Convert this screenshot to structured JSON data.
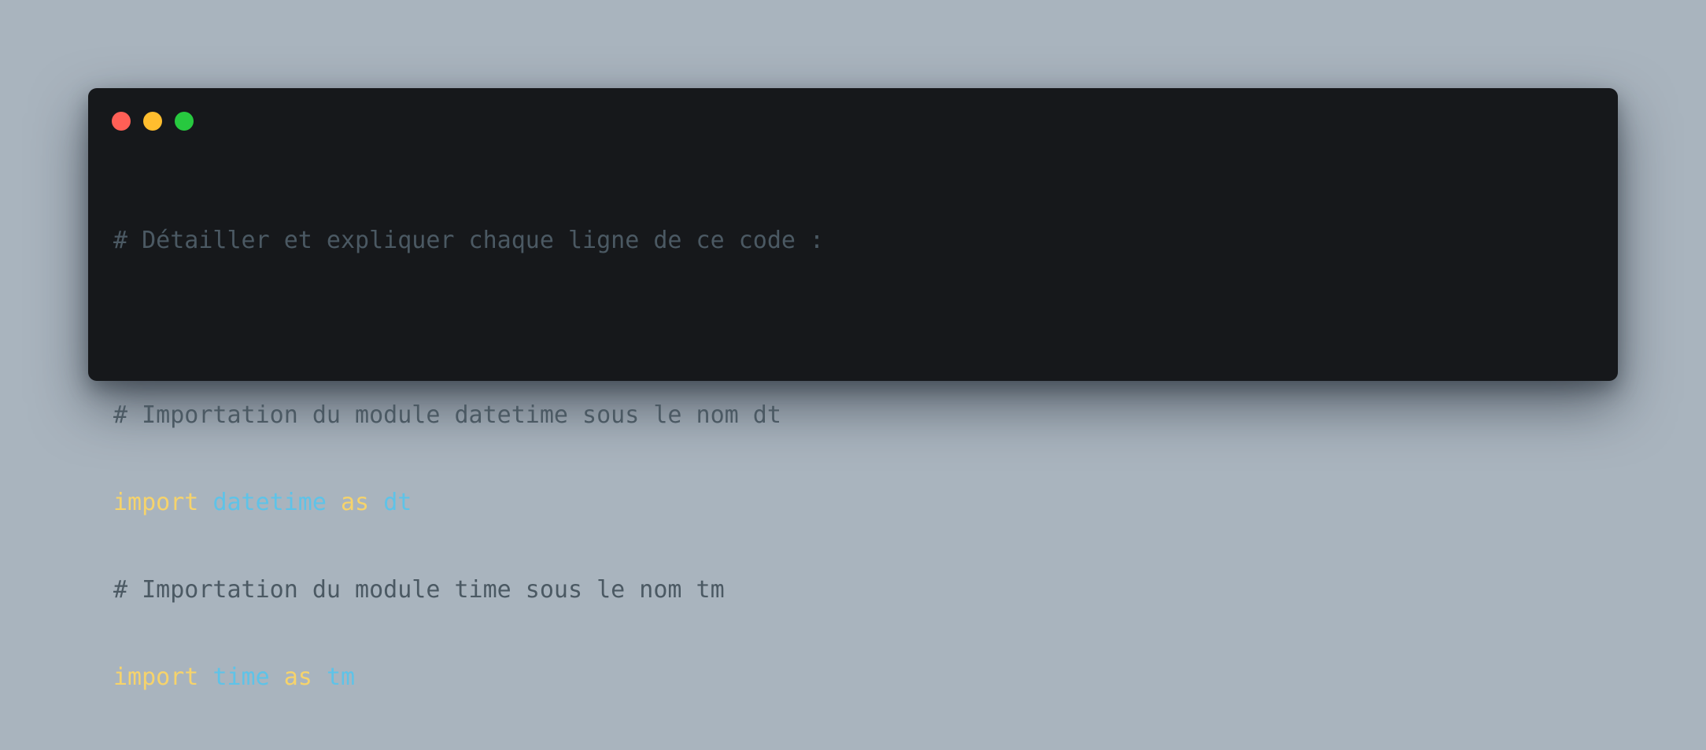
{
  "window": {
    "controls": [
      {
        "name": "close-dot",
        "color": "#ff5f56"
      },
      {
        "name": "minimize-dot",
        "color": "#ffbd2e"
      },
      {
        "name": "maximize-dot",
        "color": "#27c93f"
      }
    ]
  },
  "code": {
    "line1": {
      "comment": "# Détailler et expliquer chaque ligne de ce code :"
    },
    "line2": {
      "comment": "# Importation du module datetime sous le nom dt"
    },
    "line3": {
      "kw_import": "import",
      "module": "datetime",
      "kw_as": "as",
      "alias": "dt"
    },
    "line4": {
      "comment": "# Importation du module time sous le nom tm"
    },
    "line5": {
      "kw_import": "import",
      "module": "time",
      "kw_as": "as",
      "alias": "tm"
    }
  },
  "colors": {
    "background": "#a9b4be",
    "window": "#16181b",
    "comment": "#4b5963",
    "keyword": "#f6d36b",
    "identifier": "#5ec3e8"
  }
}
